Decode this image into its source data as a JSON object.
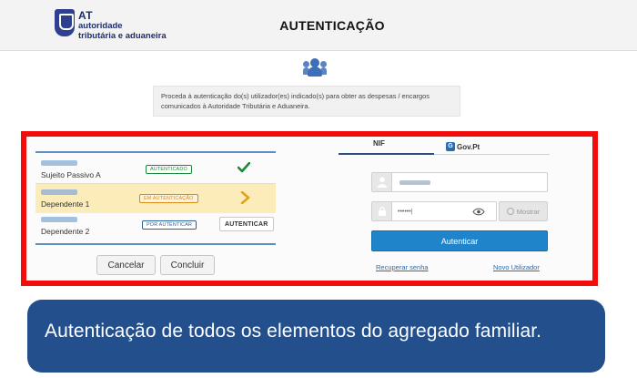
{
  "header": {
    "logo_at": "AT",
    "logo_line1": "autoridade",
    "logo_line2": "tributária e aduaneira",
    "title": "AUTENTICAÇÃO"
  },
  "intro": {
    "icon": "users-icon",
    "text": "Proceda à autenticação do(s) utilizador(es) indicado(s) para obter as despesas / encargos comunicados à Autoridade Tributária e Aduaneira."
  },
  "members": [
    {
      "name": "Sujeito Passivo A",
      "status": "AUTENTICADO",
      "status_color": "#1a8a3a",
      "action_icon": "check-icon"
    },
    {
      "name": "Dependente 1",
      "status": "EM AUTENTICAÇÃO",
      "status_color": "#d98a17",
      "action_icon": "chevron-right-icon"
    },
    {
      "name": "Dependente 2",
      "status": "POR AUTENTICAR",
      "status_color": "#2a5f96",
      "action_label": "AUTENTICAR"
    }
  ],
  "buttons": {
    "cancel": "Cancelar",
    "conclude": "Concluir"
  },
  "login": {
    "tab_nif": "NIF",
    "tab_gov": "Gov.Pt",
    "password_value": "••••••|",
    "show_password": "Mostrar",
    "submit": "Autenticar",
    "recover": "Recuperar senha",
    "new_user": "Novo Utilizador"
  },
  "caption": "Autenticação de todos os elementos do agregado familiar.",
  "colors": {
    "frame": "#f20c0c",
    "primary": "#1f84c9",
    "banner": "#23508c"
  }
}
